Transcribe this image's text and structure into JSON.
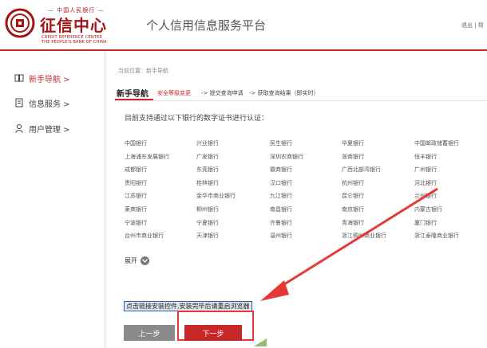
{
  "header": {
    "logo_top": "— 中国人民银行 —",
    "logo_name": "征信中心",
    "logo_en_1": "CREDIT REFERENCE CENTER",
    "logo_en_2": "THE PEOPLE'S BANK OF CHINA",
    "platform_title": "个人信用信息服务平台",
    "top_links": "退出 | 帮"
  },
  "sidebar": {
    "items": [
      {
        "label": "新手导航 >",
        "icon": "book-icon",
        "active": true
      },
      {
        "label": "信息服务 >",
        "icon": "document-icon",
        "active": false
      },
      {
        "label": "用户管理 >",
        "icon": "user-icon",
        "active": false
      }
    ]
  },
  "breadcrumb": "当前位置：新手导航",
  "steps": {
    "title": "新手导航",
    "items": [
      "安全等级变更",
      "-> 提交查询申请",
      "-> 获取查询结果（即实时）"
    ]
  },
  "intro": "目前支持通过以下银行的数字证书进行认证：",
  "banks": [
    [
      "中国银行",
      "兴业银行",
      "民生银行",
      "华夏银行",
      "中国邮政储蓄银行"
    ],
    [
      "上海浦东发展银行",
      "广发银行",
      "深圳农商银行",
      "浙商银行",
      "恒丰银行"
    ],
    [
      "成都银行",
      "东莞银行",
      "徽商银行",
      "广西北部湾银行",
      "广州银行"
    ],
    [
      "贵阳银行",
      "桂林银行",
      "汉口银行",
      "杭州银行",
      "河北银行"
    ],
    [
      "江苏银行",
      "金华市商业银行",
      "九江银行",
      "昆仑银行",
      "兰州银行"
    ],
    [
      "莱商银行",
      "柳州银行",
      "南昌银行",
      "南京银行",
      "内蒙古银行"
    ],
    [
      "宁波银行",
      "宁夏银行",
      "齐鲁银行",
      "青海银行",
      "厦门银行"
    ],
    [
      "台州市商业银行",
      "天津银行",
      "温州银行",
      "浙江稠州商业银行",
      "浙江泰隆商业银行"
    ]
  ],
  "expand_label": "展开",
  "install_link": "点击链接安装控件,安装完毕后请重启浏览器",
  "buttons": {
    "prev": "上一步",
    "next": "下一步"
  },
  "colors": {
    "brand_red": "#c62828",
    "annotation_red": "#e53935",
    "prev_gray": "#8a8a8a"
  }
}
